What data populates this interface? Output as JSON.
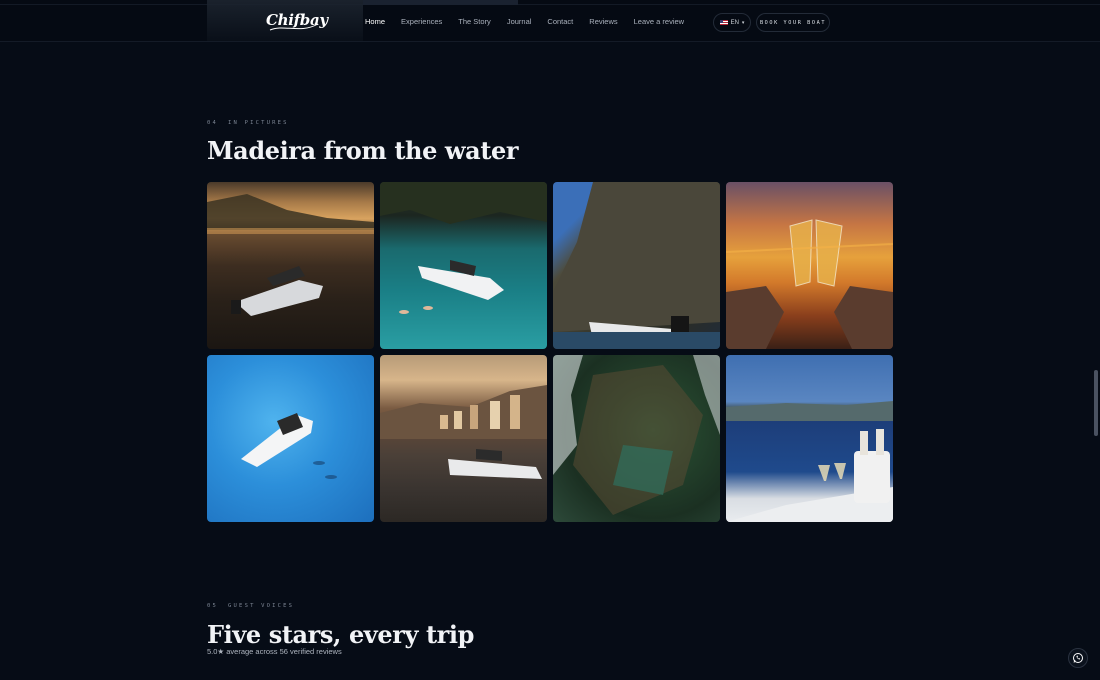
{
  "brand": {
    "logo_text": "Chifbay"
  },
  "nav": {
    "links": [
      {
        "label": "Home",
        "active": true
      },
      {
        "label": "Experiences",
        "active": false
      },
      {
        "label": "The Story",
        "active": false
      },
      {
        "label": "Journal",
        "active": false
      },
      {
        "label": "Contact",
        "active": false
      },
      {
        "label": "Reviews",
        "active": false
      },
      {
        "label": "Leave a review",
        "active": false
      }
    ],
    "language": {
      "flag_icon": "us-flag-icon",
      "label": "EN",
      "caret": "▾"
    },
    "cta_label": "BOOK YOUR BOAT"
  },
  "gallery_section": {
    "number": "04",
    "eyebrow": "IN PICTURES",
    "title": "Madeira from the water",
    "photos": [
      {
        "subject": "boat-at-sunset-coast"
      },
      {
        "subject": "boat-turquoise-cove-swimmers"
      },
      {
        "subject": "boat-below-sea-cliff"
      },
      {
        "subject": "champagne-toast-sunset"
      },
      {
        "subject": "aerial-boat-blue-sea"
      },
      {
        "subject": "boat-harbor-town-sunset"
      },
      {
        "subject": "aerial-rocky-coastline"
      },
      {
        "subject": "champagne-on-deck-funchal"
      }
    ]
  },
  "reviews_section": {
    "number": "05",
    "eyebrow": "GUEST VOICES",
    "title": "Five stars, every trip",
    "rating_text": "5.0★ average across 56 verified reviews"
  },
  "whatsapp": {
    "icon": "whatsapp-icon"
  },
  "colors": {
    "background": "#060c16",
    "text": "#f1f3f6",
    "muted": "#7c8593"
  }
}
